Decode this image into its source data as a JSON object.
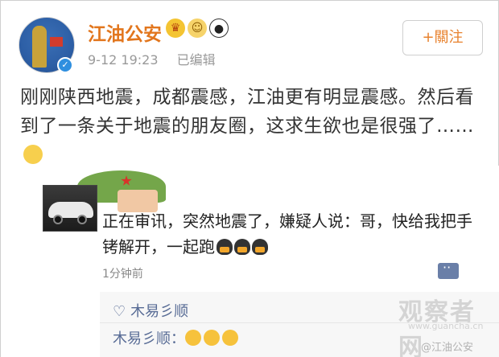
{
  "post": {
    "author": "江油公安",
    "badges": [
      "crown-badge",
      "gold-badge",
      "panda-badge"
    ],
    "time": "9-12 19:23",
    "edited": "已编辑",
    "follow_label": "+關注",
    "text": "刚刚陕西地震，成都震感，江油更有明显震感。然后看到了一条关于地震的朋友圈，这求生欲也是很强了……"
  },
  "moment": {
    "text": "正在审讯，突然地震了，嫌疑人说：哥，快给我把手铐解开，一起跑",
    "time_ago": "1分钟前",
    "like_user": "木易彡顺",
    "reply_user": "木易彡顺："
  },
  "watermarks": {
    "site": "观察者网",
    "url": "www.guancha.cn",
    "weibo": "@江油公安"
  },
  "colors": {
    "author": "#e2761d",
    "link": "#576b95",
    "verified": "#2f8fdf"
  }
}
